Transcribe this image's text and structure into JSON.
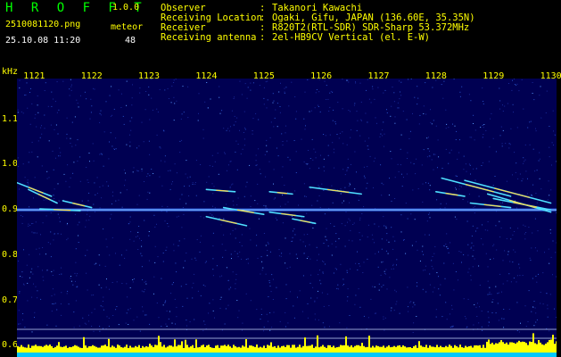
{
  "header": {
    "app_title": "H R O F F T",
    "version": "1.0.0",
    "filename": "2510081120.png",
    "datetime": "25.10.08 11:20",
    "count_label": "meteor",
    "count_value": "48"
  },
  "info": {
    "labels": [
      "Observer",
      "Receiving Location",
      "Receiver",
      "Receiving antenna"
    ],
    "separator": ":",
    "values": [
      "Takanori Kawachi",
      "Ogaki, Gifu, JAPAN (136.60E, 35.35N)",
      "R820T2(RTL-SDR) SDR-Sharp 53.372MHz",
      "2el-HB9CV Vertical (el. E-W)"
    ]
  },
  "axis": {
    "unit": "kHz",
    "x_ticks": [
      "1121",
      "1122",
      "1123",
      "1124",
      "1125",
      "1126",
      "1127",
      "1128",
      "1129",
      "1130"
    ],
    "y_ticks": [
      "1.1",
      "1.0",
      "0.9",
      "0.8",
      "0.7",
      "0.6"
    ]
  },
  "chart_data": {
    "type": "heatmap",
    "x_range": [
      1120.7,
      1130.1
    ],
    "y_range": [
      0.575,
      1.19
    ],
    "baseline_khz": 0.9,
    "colors": {
      "background": "#000052",
      "baseline": "#3a78ff",
      "trail_cool": "#4fe0ff",
      "trail_hot": "#ffd84a",
      "bar": "#ffff00",
      "bar_base": "#00c8ff",
      "axis_text": "#ffff00"
    },
    "trails": [
      {
        "x": [
          1120.7,
          1121.3
        ],
        "y": [
          0.96,
          0.93
        ]
      },
      {
        "x": [
          1120.9,
          1121.4
        ],
        "y": [
          0.945,
          0.915
        ]
      },
      {
        "x": [
          1121.5,
          1122.0
        ],
        "y": [
          0.92,
          0.905
        ]
      },
      {
        "x": [
          1121.1,
          1121.8
        ],
        "y": [
          0.902,
          0.898
        ]
      },
      {
        "x": [
          1124.0,
          1124.7
        ],
        "y": [
          0.885,
          0.865
        ]
      },
      {
        "x": [
          1124.3,
          1125.0
        ],
        "y": [
          0.905,
          0.89
        ]
      },
      {
        "x": [
          1125.1,
          1125.7
        ],
        "y": [
          0.895,
          0.885
        ]
      },
      {
        "x": [
          1125.5,
          1125.9
        ],
        "y": [
          0.88,
          0.87
        ]
      },
      {
        "x": [
          1124.0,
          1124.5
        ],
        "y": [
          0.945,
          0.94
        ]
      },
      {
        "x": [
          1125.1,
          1125.5
        ],
        "y": [
          0.94,
          0.935
        ]
      },
      {
        "x": [
          1125.8,
          1126.7
        ],
        "y": [
          0.95,
          0.935
        ]
      },
      {
        "x": [
          1128.0,
          1128.5
        ],
        "y": [
          0.94,
          0.93
        ]
      },
      {
        "x": [
          1128.1,
          1129.3
        ],
        "y": [
          0.97,
          0.93
        ]
      },
      {
        "x": [
          1128.5,
          1130.0
        ],
        "y": [
          0.965,
          0.915
        ]
      },
      {
        "x": [
          1128.9,
          1130.0
        ],
        "y": [
          0.935,
          0.895
        ]
      },
      {
        "x": [
          1129.0,
          1130.0
        ],
        "y": [
          0.925,
          0.9
        ]
      },
      {
        "x": [
          1128.6,
          1129.3
        ],
        "y": [
          0.915,
          0.905
        ]
      }
    ]
  }
}
